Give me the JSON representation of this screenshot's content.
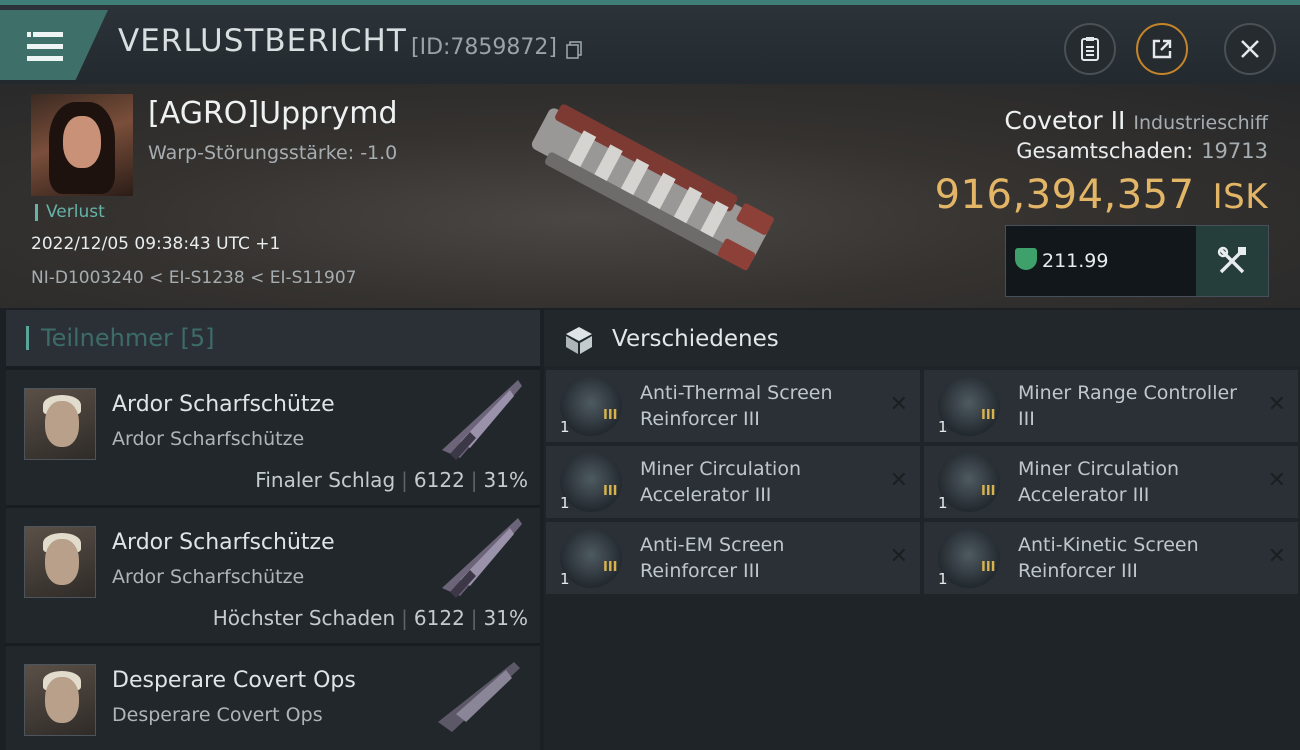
{
  "header": {
    "title": "VERLUSTBERICHT",
    "report_id": "[ID:7859872]"
  },
  "victim": {
    "pilot_name": "[AGRO]Upprymd",
    "warp_disruption": "Warp-Störungsstärke: -1.0",
    "status": "Verlust",
    "datetime": "2022/12/05 09:38:43 UTC +1",
    "route": "NI-D1003240 < EI-S1238 < EI-S11907",
    "ship_name": "Covetor II",
    "ship_class": "Industrieschiff",
    "total_damage_label": "Gesamtschaden:",
    "total_damage_value": "19713",
    "isk_value": "916,394,357",
    "isk_unit": "ISK",
    "secondary_value": "211.99"
  },
  "participants": {
    "header_label": "Teilnehmer [5]",
    "rows": [
      {
        "pilot": "Ardor Scharfschütze",
        "subtitle": "Ardor Scharfschütze",
        "role": "Finaler Schlag",
        "damage": "6122",
        "percent": "31%"
      },
      {
        "pilot": "Ardor Scharfschütze",
        "subtitle": "Ardor Scharfschütze",
        "role": "Höchster Schaden",
        "damage": "6122",
        "percent": "31%"
      },
      {
        "pilot": "Desperare Covert Ops",
        "subtitle": "Desperare Covert Ops",
        "role": "",
        "damage": "",
        "percent": ""
      }
    ]
  },
  "misc": {
    "header_label": "Verschiedenes",
    "items": [
      {
        "name": "Anti-Thermal Screen Reinforcer III",
        "qty": "1",
        "level": "III",
        "icon": "shield-rig-icon"
      },
      {
        "name": "Miner Range Controller III",
        "qty": "1",
        "level": "III",
        "icon": "mining-rig-icon"
      },
      {
        "name": "Miner Circulation Accelerator III",
        "qty": "1",
        "level": "III",
        "icon": "mining-rig-icon"
      },
      {
        "name": "Miner Circulation Accelerator III",
        "qty": "1",
        "level": "III",
        "icon": "mining-rig-icon"
      },
      {
        "name": "Anti-EM Screen Reinforcer III",
        "qty": "1",
        "level": "III",
        "icon": "shield-rig-icon"
      },
      {
        "name": "Anti-Kinetic Screen Reinforcer III",
        "qty": "1",
        "level": "III",
        "icon": "shield-rig-icon"
      }
    ],
    "dropped_mark": "✕"
  },
  "colors": {
    "accent_teal": "#3f7d77",
    "isk_gold": "#e3b667",
    "loss_green": "#66b3a8"
  }
}
